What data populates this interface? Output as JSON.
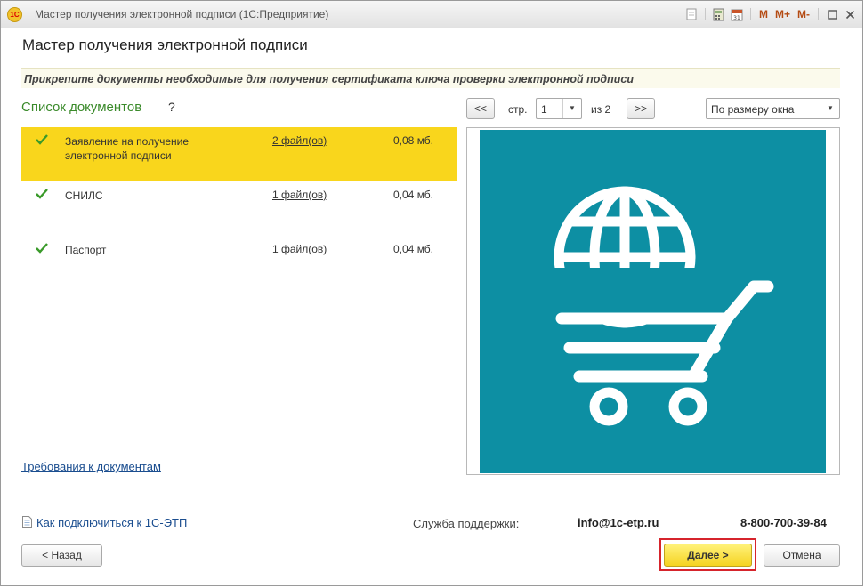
{
  "window": {
    "title": "Мастер получения электронной подписи  (1С:Предприятие)",
    "logo_text": "1С",
    "toolbar": {
      "m_label": "M",
      "m_plus_label": "M+",
      "m_minus_label": "M-",
      "calendar_day": "31"
    }
  },
  "header": {
    "title": "Мастер получения электронной подписи",
    "subtitle": "Прикрепите документы  необходимые для получения сертификата ключа проверки электронной подписи"
  },
  "documents": {
    "title": "Список документов",
    "help": "?",
    "items": [
      {
        "name": "Заявление на получение электронной подписи",
        "files": "2 файл(ов)",
        "size": "0,08 мб.",
        "selected": true
      },
      {
        "name": "СНИЛС",
        "files": "1 файл(ов)",
        "size": "0,04 мб.",
        "selected": false
      },
      {
        "name": "Паспорт",
        "files": "1 файл(ов)",
        "size": "0,04 мб.",
        "selected": false
      }
    ],
    "requirements_link": "Требования к документам"
  },
  "preview": {
    "prev_label": "<<",
    "page_label": "стр.",
    "page_value": "1",
    "of_label": "из 2",
    "next_label": ">>",
    "zoom_value": "По размеру окна",
    "image_bg": "#0d8fa3"
  },
  "footer": {
    "connect_link": "Как подключиться к 1С-ЭТП",
    "support_label": "Служба поддержки:",
    "support_email": "info@1c-etp.ru",
    "support_phone": "8-800-700-39-84",
    "back_label": "< Назад",
    "next_label": "Далее >",
    "cancel_label": "Отмена"
  },
  "colors": {
    "selected_row": "#f9d61c",
    "list_title": "#3a8a2a",
    "check": "#3a9a2a",
    "link": "#1a4d8f",
    "highlight_outline": "#d6242c"
  }
}
